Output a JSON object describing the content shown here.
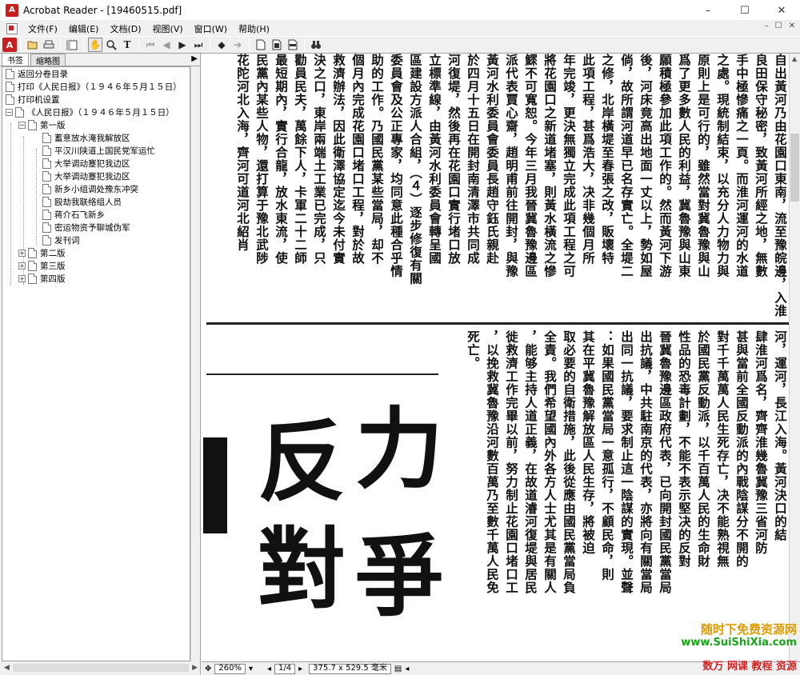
{
  "window": {
    "title": "Acrobat Reader - [19460515.pdf]",
    "app_icon": "A",
    "minimize": "–",
    "maximize": "☐",
    "close": "✕"
  },
  "menu": {
    "items": [
      "文件(F)",
      "编辑(E)",
      "文档(D)",
      "视图(V)",
      "窗口(W)",
      "帮助(H)"
    ],
    "mdi": [
      "–",
      "☐",
      "✕"
    ]
  },
  "toolbar": {
    "icons": [
      "acrobat-logo",
      "open-folder",
      "print",
      "show-hide-navigation",
      "hand-tool",
      "zoom-tool",
      "text-select-tool",
      "first-page",
      "previous-page",
      "next-page",
      "last-page",
      "go-back",
      "go-forward",
      "actual-size",
      "fit-page",
      "fit-width",
      "find"
    ]
  },
  "left_pane": {
    "tabs": [
      "书签",
      "缩略图"
    ],
    "tree": [
      {
        "label": "返回分卷目录",
        "level": 0
      },
      {
        "label": "打印《人民日报》（１９４６年５月１５日）",
        "level": 0
      },
      {
        "label": "打印机设置",
        "level": 0
      },
      {
        "label": "《人民日报》（１９４６年５月１５日）",
        "level": 0,
        "expander": "−"
      },
      {
        "label": "第一版",
        "level": 1,
        "expander": "−"
      },
      {
        "label": "蓄意放水淹我解放区",
        "level": 2
      },
      {
        "label": "平汉川陕道上国民党军运忙",
        "level": 2
      },
      {
        "label": "大举调动蹇犯我边区",
        "level": 2
      },
      {
        "label": "大举调动蹇犯我边区",
        "level": 2
      },
      {
        "label": "新乡小组调处豫东冲突",
        "level": 2
      },
      {
        "label": "殴劫我联络组人员",
        "level": 2
      },
      {
        "label": "蒋介石飞新乡",
        "level": 2
      },
      {
        "label": "密运物资予聊城伪军",
        "level": 2
      },
      {
        "label": "发刊词",
        "level": 2
      },
      {
        "label": "第二版",
        "level": 1,
        "expander": "+"
      },
      {
        "label": "第三版",
        "level": 1,
        "expander": "+"
      },
      {
        "label": "第四版",
        "level": 1,
        "expander": "+"
      }
    ]
  },
  "document": {
    "upper_columns": [
      "自出黃河乃由花園口東南，流至豫皖邊，入淮河，轉運河，長江入海。黃河決口的結果",
      "良田保守秘密，致黃河所經之地，無數",
      "手中極慘痛之一頁。而淮河運河的水道",
      "之處。現統制結束，以充分人力物力與",
      "原則上是可行的，雖然當對冀魯豫與山",
      "爲了更多數人民的利益，冀魯豫與山東",
      "願積極參加此項工作的。然而黃河下游",
      "後，河床竟高出地面一丈以上，勢如屋",
      "倘，故所謂河道早已名存實亡。全堤二",
      "之修，北岸橫堤至春張之改，販壞特",
      "此項工程，甚爲浩大，决非幾個月所",
      "年完竣，更決無獨立完成此項工程之可",
      "將花園口之新道堵塞，則黃水橫流之慘",
      "鰥不可寬恕。今年三月我晉冀魯豫邊區",
      "派代表賈心齋，趙明甫前往開封，與豫",
      "黃河水利委員會委員長趙守鈺氏親赴",
      "於四月十五日在開封南清澤市共同成",
      "河復堤，然後再在花園口實行堵口放",
      "立標準線，由黃河水利委員會轉呈國",
      "區建設方派人合組，（４）逐步修復有關",
      "委員會及公正專家，均同意此種合乎情",
      "助的工作。乃國民黨某些當局，却不",
      "個月內完成花園口堵口工程，對於故",
      "救濟辦法，因此衛澤協定迄今未付實",
      "決之口，東岸兩端土工業已完成，只",
      "勸員民夫，萬餘下人，卡軍二十二師",
      "最短期內，實行合龍，放水東流，使",
      "民黨內某些人物，還打算于豫北武陟",
      "花陀河北入海，齊河可道河北紹肖"
    ],
    "lower_columns": [
      "河，運河，長江入海。黃河決口的結",
      "肆淮河爲名，齊齊淮幾魯冀豫三省河防",
      "甚與當前全國反動派的內戰陰謀分不開的",
      "對千千萬萬人民生死存亡，决不能熟視無",
      "於國民黨反動派，以千百萬人民的生命財",
      "性品的恐毒計劃，不能不表示堅决的反對",
      "晉冀魯豫邊區政府代表，已向開封國民黨當局",
      "出抗議，中共駐南京的代表，亦將向有關當局",
      "出同一抗議，要求制止這一陰謀的實現。並聲",
      "：如果國民黨當局一意孤行，不顧民命，則",
      "其在平冀魯豫解放區人民生存，將被迫",
      "取必要的自衛措施，此後從應由國民黨當局負",
      "全責。我們希望國內外各方人士尤其是有關人",
      "，能够主持人道正義，在故道濬河復堤與居民",
      "徙救濟工作完畢以前，努力制止花園口堵口工",
      "，以挽救冀魯豫沿河數百萬乃至數千萬人民免",
      "死亡。"
    ],
    "headline_chars": [
      "反",
      "對",
      "力",
      "爭"
    ]
  },
  "statusbar": {
    "zoom": "260%",
    "page": "1/4",
    "page_size": "375.7 x 529.5 毫米"
  },
  "watermarks": [
    "随时下免费资源网",
    "www.SuiShiXia.com",
    "数万 网课 教程 资源"
  ]
}
